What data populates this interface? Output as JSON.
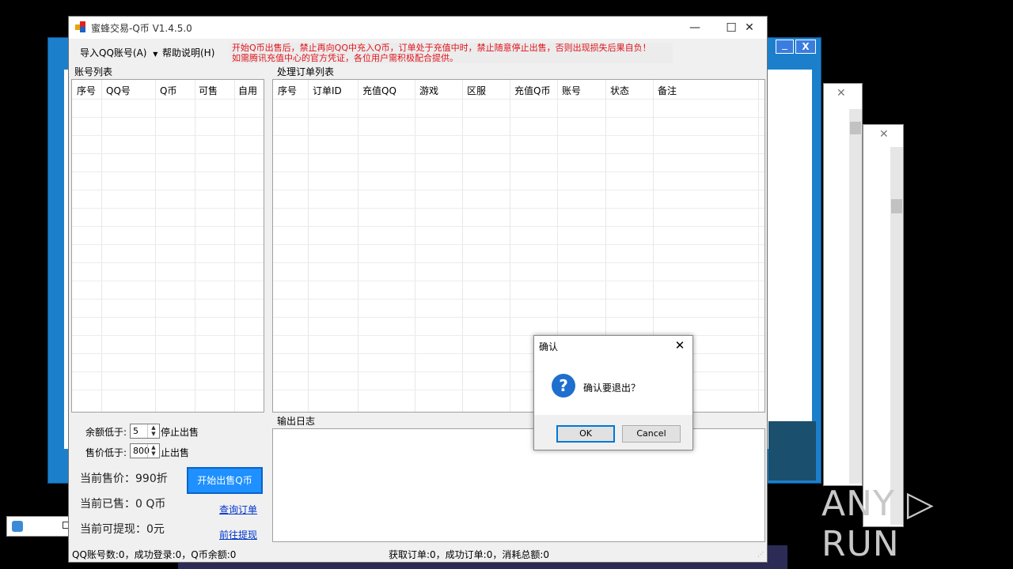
{
  "main_window": {
    "title": "蜜蜂交易-Q币 V1.4.5.0",
    "min_icon": "—",
    "max_icon": "☐",
    "close_icon": "✕"
  },
  "menu": {
    "import_label": "导入QQ账号(A)",
    "help_label": "帮助说明(H)"
  },
  "warning": {
    "line1": "开始Q币出售后，禁止再向QQ中充入Q币，订单处于充值中时，禁止随意停止出售，否则出现损失后果自负！",
    "line2": "如需腾讯充值中心的官方凭证，各位用户需积极配合提供。"
  },
  "accounts": {
    "group_label": "账号列表",
    "columns": [
      "序号",
      "QQ号",
      "Q币",
      "可售",
      "自用"
    ]
  },
  "orders": {
    "group_label": "处理订单列表",
    "columns": [
      "序号",
      "订单ID",
      "充值QQ",
      "游戏",
      "区服",
      "充值Q币",
      "账号",
      "状态",
      "备注"
    ]
  },
  "controls": {
    "balance_label": "余额低于:",
    "balance_value": "5",
    "balance_suffix": "停止出售",
    "price_label": "售价低于:",
    "price_value": "800",
    "price_suffix": "止出售",
    "current_price": "当前售价：990折",
    "current_sold": "当前已售：0 Q币",
    "current_withdraw": "当前可提现：0元",
    "start_button": "开始出售Q币",
    "query_link": "查询订单",
    "withdraw_link": "前往提现"
  },
  "log": {
    "group_label": "输出日志"
  },
  "status_bar": {
    "left": "QQ账号数:0，成功登录:0，Q币余额:0",
    "right": "获取订单:0，成功订单:0，消耗总额:0"
  },
  "dialog": {
    "title": "确认",
    "close_icon": "✕",
    "icon_glyph": "?",
    "message": "确认要退出？",
    "ok_label": "OK",
    "cancel_label": "Cancel"
  },
  "background": {
    "xp_close": "X",
    "xp_min": "_",
    "small_close": "✕",
    "watermark": "ANY ▷ RUN"
  }
}
